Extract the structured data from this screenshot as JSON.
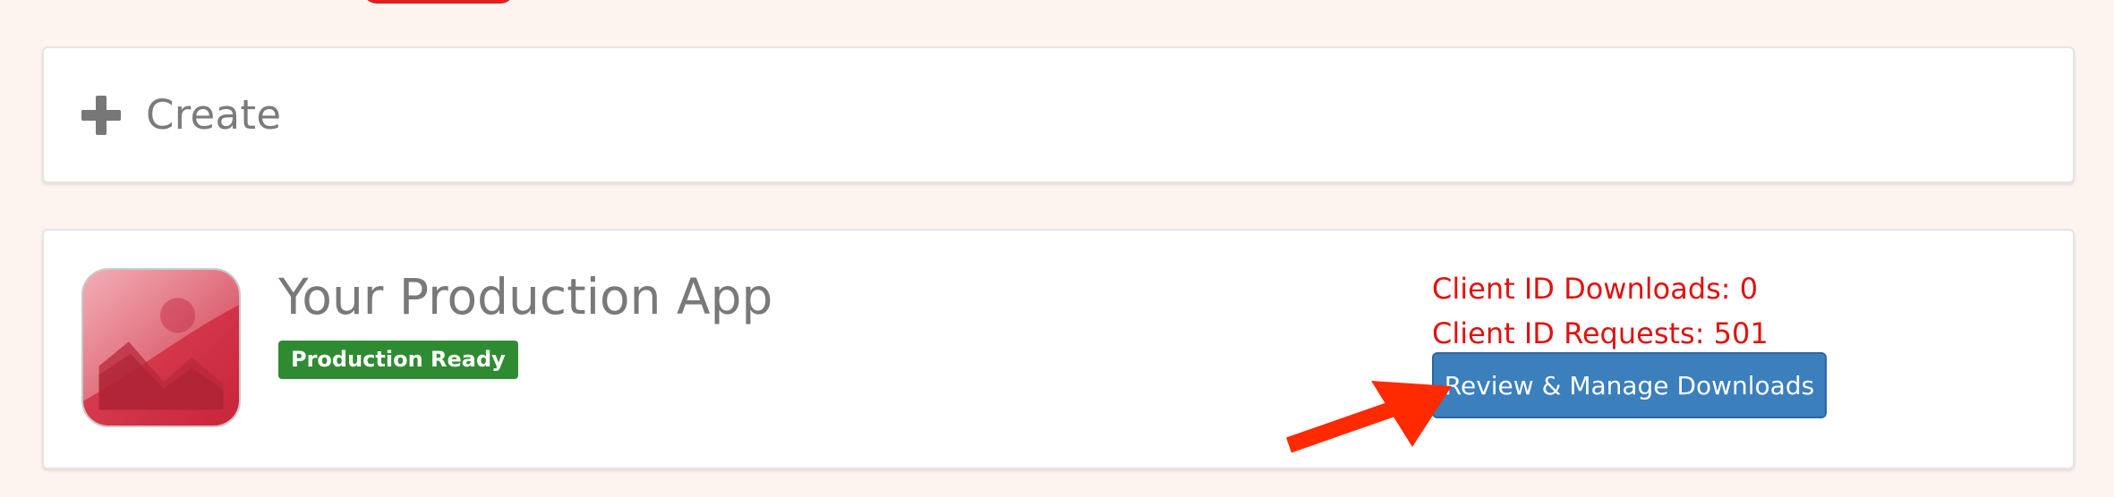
{
  "create": {
    "label": "Create",
    "icon": "plus-icon"
  },
  "app": {
    "name": "Your Production App",
    "status": "Production Ready",
    "icon": "app-image-icon",
    "stats": {
      "downloads_label": "Client ID Downloads: 0",
      "requests_label": "Client ID Requests: 501"
    },
    "action_button": {
      "label": "Review & Manage Downloads"
    }
  },
  "colors": {
    "page_background": "#fdf3ef",
    "accent_red": "#e0201f",
    "stats_red": "#e0120f",
    "status_green": "#2f8b32",
    "button_blue": "#3b7fbd",
    "muted_text": "#797979"
  },
  "annotation": {
    "type": "arrow",
    "target": "downloads-button",
    "color": "#ff2a00"
  }
}
